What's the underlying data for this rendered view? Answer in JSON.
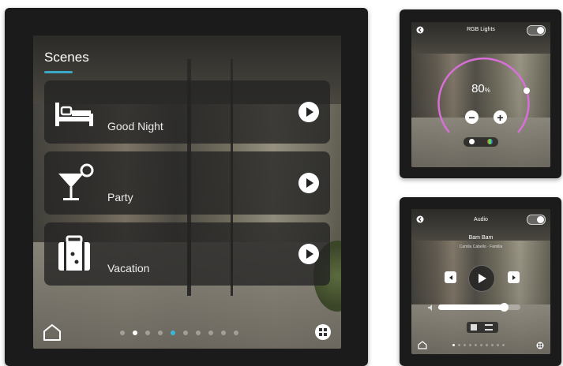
{
  "main_panel": {
    "title": "Scenes",
    "scenes": [
      {
        "label": "Good Night",
        "icon": "bed-icon"
      },
      {
        "label": "Party",
        "icon": "cocktail-glass-icon"
      },
      {
        "label": "Vacation",
        "icon": "suitcase-icon"
      }
    ],
    "page_dots": 10,
    "active_dot_white": 1,
    "active_dot_blue": 4,
    "accent_color": "#3aa7c4"
  },
  "lights_panel": {
    "title": "RGB Lights",
    "dim_level": "80",
    "dim_unit": "%",
    "ring_color": "#d86fd8"
  },
  "audio_panel": {
    "title": "Audio",
    "track_title": "Bam Bam",
    "track_subtitle": "Camila Cabello · Familia",
    "volume_fraction": 0.8
  }
}
